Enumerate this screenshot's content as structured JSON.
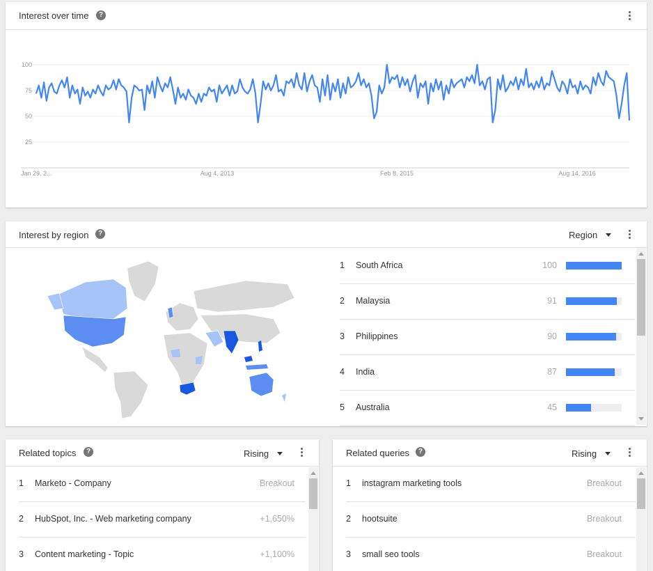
{
  "interest_over_time": {
    "title": "Interest over time",
    "help": "?",
    "chart_data": {
      "type": "line",
      "title": "",
      "xlabel": "",
      "ylabel": "",
      "ylim": [
        0,
        100
      ],
      "yticks": [
        25,
        50,
        75,
        100
      ],
      "xtick_labels": [
        "Jan 29, 2...",
        "Aug 4, 2013",
        "Feb 8, 2015",
        "Aug 14, 2016"
      ],
      "x_start": "2012-01-29",
      "x_end": "2017-01-22",
      "color": "#4285f4",
      "series": [
        {
          "values": [
            72,
            80,
            68,
            83,
            65,
            78,
            82,
            74,
            72,
            80,
            85,
            78,
            88,
            68,
            80,
            72,
            76,
            62,
            78,
            70,
            74,
            68,
            76,
            72,
            80,
            74,
            70,
            80,
            76,
            78,
            85,
            76,
            86,
            80,
            78,
            74,
            44,
            68,
            80,
            78,
            75,
            76,
            56,
            80,
            72,
            84,
            68,
            88,
            80,
            74,
            82,
            78,
            88,
            76,
            62,
            78,
            68,
            72,
            66,
            76,
            70,
            68,
            62,
            72,
            64,
            72,
            70,
            78,
            74,
            76,
            64,
            80,
            72,
            76,
            80,
            70,
            80,
            72,
            74,
            86,
            78,
            74,
            72,
            76,
            86,
            72,
            44,
            62,
            84,
            76,
            82,
            75,
            80,
            90,
            74,
            76,
            70,
            84,
            82,
            86,
            78,
            92,
            80,
            76,
            92,
            74,
            84,
            90,
            80,
            78,
            64,
            86,
            70,
            90,
            66,
            82,
            74,
            86,
            68,
            82,
            72,
            88,
            78,
            80,
            84,
            92,
            80,
            86,
            78,
            82,
            70,
            48,
            54,
            80,
            72,
            78,
            100,
            82,
            88,
            86,
            90,
            78,
            88,
            80,
            86,
            74,
            84,
            90,
            68,
            82,
            78,
            84,
            62,
            82,
            74,
            86,
            76,
            84,
            66,
            80,
            72,
            86,
            78,
            82,
            84,
            86,
            78,
            88,
            84,
            90,
            82,
            100,
            80,
            84,
            76,
            86,
            88,
            44,
            56,
            86,
            76,
            90,
            74,
            78,
            84,
            80,
            88,
            76,
            86,
            80,
            96,
            78,
            82,
            76,
            84,
            78,
            88,
            76,
            82,
            80,
            94,
            86,
            78,
            74,
            84,
            80,
            72,
            86,
            78,
            80,
            72,
            84,
            76,
            80,
            78,
            72,
            88,
            80,
            92,
            84,
            80,
            94,
            88,
            86,
            84,
            70,
            48,
            62,
            80,
            92,
            46
          ]
        }
      ]
    }
  },
  "interest_by_region": {
    "title": "Interest by region",
    "help": "?",
    "dropdown": "Region",
    "rows": [
      {
        "rank": "1",
        "name": "South Africa",
        "value": "100",
        "pct": 1.0
      },
      {
        "rank": "2",
        "name": "Malaysia",
        "value": "91",
        "pct": 0.91
      },
      {
        "rank": "3",
        "name": "Philippines",
        "value": "90",
        "pct": 0.9
      },
      {
        "rank": "4",
        "name": "India",
        "value": "87",
        "pct": 0.87
      },
      {
        "rank": "5",
        "name": "Australia",
        "value": "45",
        "pct": 0.45
      }
    ],
    "colors": {
      "high": "#1a57e0",
      "mid": "#5b8ef0",
      "low": "#a6c4f7",
      "none": "#d9d9d9",
      "bar": "#4285f4"
    }
  },
  "related_topics": {
    "title": "Related topics",
    "help": "?",
    "dropdown": "Rising",
    "rows": [
      {
        "rank": "1",
        "name": "Marketo - Company",
        "value": "Breakout"
      },
      {
        "rank": "2",
        "name": "HubSpot, Inc. - Web marketing company",
        "value": "+1,650%"
      },
      {
        "rank": "3",
        "name": "Content marketing - Topic",
        "value": "+1,100%"
      }
    ]
  },
  "related_queries": {
    "title": "Related queries",
    "help": "?",
    "dropdown": "Rising",
    "rows": [
      {
        "rank": "1",
        "name": "instagram marketing tools",
        "value": "Breakout"
      },
      {
        "rank": "2",
        "name": "hootsuite",
        "value": "Breakout"
      },
      {
        "rank": "3",
        "name": "small seo tools",
        "value": "Breakout"
      }
    ]
  }
}
